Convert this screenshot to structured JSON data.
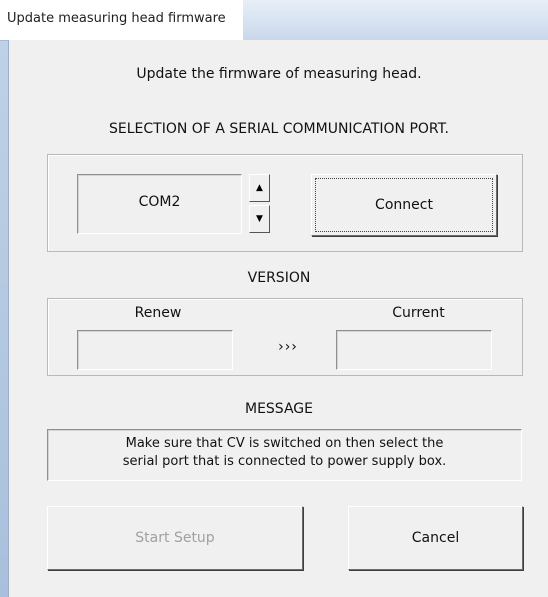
{
  "window": {
    "title": "Update measuring head firmware"
  },
  "intro": {
    "text": "Update the firmware of measuring head."
  },
  "port": {
    "heading": "SELECTION OF A SERIAL COMMUNICATION PORT.",
    "value": "COM2",
    "up_glyph": "▲",
    "down_glyph": "▼",
    "connect_label": "Connect"
  },
  "version": {
    "heading": "VERSION",
    "renew_label": "Renew",
    "current_label": "Current",
    "arrow": "›››",
    "renew_value": "",
    "current_value": ""
  },
  "message": {
    "heading": "MESSAGE",
    "line1": "Make sure that CV is switched on then select the",
    "line2": "serial port that is connected to power supply box."
  },
  "actions": {
    "start_label": "Start Setup",
    "cancel_label": "Cancel",
    "start_enabled": false
  },
  "colors": {
    "dialog_bg": "#f0f0f0",
    "disabled_text": "#a0a0a0",
    "frame_blue": "#bfd1e7"
  }
}
